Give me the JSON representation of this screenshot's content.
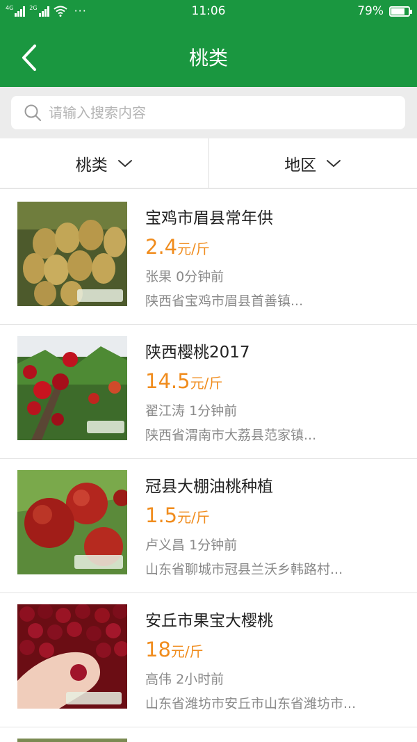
{
  "status_bar": {
    "network_1": "4G",
    "network_2": "2G",
    "more": "···",
    "time": "11:06",
    "battery": "79%",
    "battery_level": 0.79
  },
  "header": {
    "title": "桃类",
    "back_icon": "chevron-left-icon"
  },
  "search": {
    "placeholder": "请输入搜索内容",
    "icon": "search-icon"
  },
  "filters": [
    {
      "label": "桃类",
      "icon": "chevron-down-icon"
    },
    {
      "label": "地区",
      "icon": "chevron-down-icon"
    }
  ],
  "listings": [
    {
      "title": "宝鸡市眉县常年供",
      "price": "2.4",
      "unit": "元/斤",
      "seller": "张果",
      "time": "0分钟前",
      "location": "陕西省宝鸡市眉县首善镇..."
    },
    {
      "title": "陕西樱桃2017",
      "price": "14.5",
      "unit": "元/斤",
      "seller": "翟江涛",
      "time": "1分钟前",
      "location": "陕西省渭南市大荔县范家镇..."
    },
    {
      "title": "冠县大棚油桃种植",
      "price": "1.5",
      "unit": "元/斤",
      "seller": "卢义昌",
      "time": "1分钟前",
      "location": "山东省聊城市冠县兰沃乡韩路村..."
    },
    {
      "title": "安丘市果宝大樱桃",
      "price": "18",
      "unit": "元/斤",
      "seller": "高伟",
      "time": "2小时前",
      "location": "山东省潍坊市安丘市山东省潍坊市..."
    }
  ],
  "colors": {
    "brand_green": "#1a9740",
    "price_orange": "#f08c1d",
    "meta_gray": "#8a8a8a"
  }
}
